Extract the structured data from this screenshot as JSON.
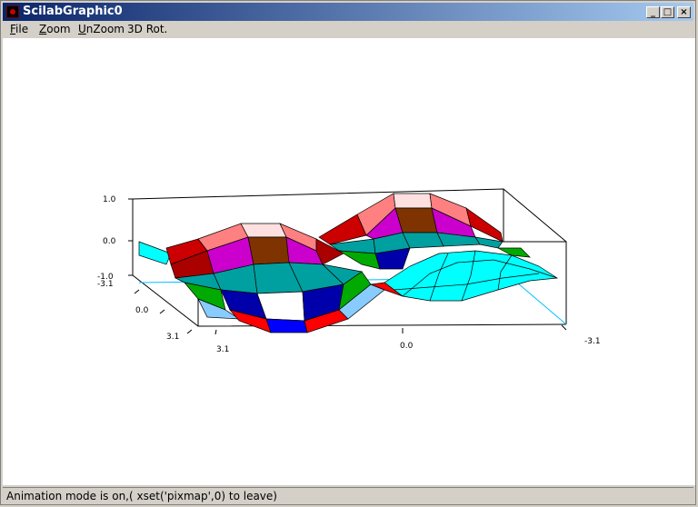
{
  "window": {
    "title": "ScilabGraphic0",
    "minimize": "_",
    "maximize": "□",
    "close": "×"
  },
  "menu": [
    {
      "label": "File",
      "underline": "F",
      "rest": "ile"
    },
    {
      "label": "Zoom",
      "underline": "Z",
      "rest": "oom"
    },
    {
      "label": "UnZoom",
      "underline": "U",
      "rest": "nZoom"
    },
    {
      "label": "3D Rot.",
      "underline": "",
      "rest": "3D Rot."
    }
  ],
  "plot": {
    "z_ticks": [
      "1.0",
      "0.0",
      "-1.0"
    ],
    "y_ticks": [
      "-3.1",
      "0.0",
      "3.1"
    ],
    "x_ticks": [
      "3.1",
      "0.0",
      "-3.1"
    ]
  },
  "status": {
    "text": "Animation mode is on,( xset('pixmap',0) to leave)"
  },
  "colors": {
    "surface_cyan": "#00ffff",
    "teal": "#00a0a0",
    "magenta": "#cc00cc",
    "brown": "#7f3300",
    "red": "#ff0000",
    "blue": "#0000cc",
    "green": "#00aa00"
  }
}
